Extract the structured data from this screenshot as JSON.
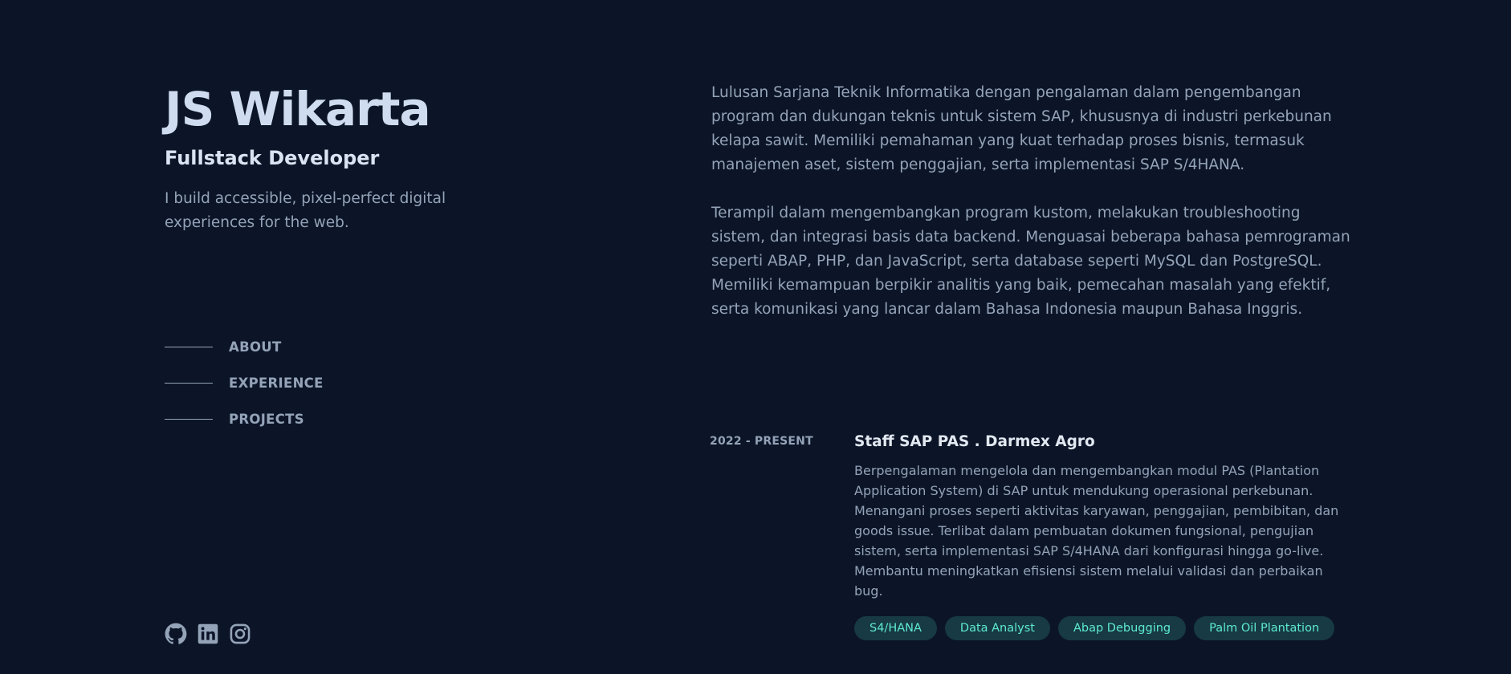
{
  "profile": {
    "name": "JS Wikarta",
    "role": "Fullstack Developer",
    "tagline": "I build accessible, pixel-perfect digital experiences for the web."
  },
  "nav": {
    "items": [
      {
        "label": "ABOUT"
      },
      {
        "label": "EXPERIENCE"
      },
      {
        "label": "PROJECTS"
      }
    ]
  },
  "social": {
    "icons": [
      "github-icon",
      "linkedin-icon",
      "instagram-icon"
    ]
  },
  "about": {
    "paragraphs": [
      "Lulusan Sarjana Teknik Informatika dengan pengalaman dalam pengembangan program dan dukungan teknis untuk sistem SAP, khususnya di industri perkebunan kelapa sawit. Memiliki pemahaman yang kuat terhadap proses bisnis, termasuk manajemen aset, sistem penggajian, serta implementasi SAP S/4HANA.",
      "Terampil dalam mengembangkan program kustom, melakukan troubleshooting sistem, dan integrasi basis data backend. Menguasai beberapa bahasa pemrograman seperti ABAP, PHP, dan JavaScript, serta database seperti MySQL dan PostgreSQL. Memiliki kemampuan berpikir analitis yang baik, pemecahan masalah yang efektif, serta komunikasi yang lancar dalam Bahasa Indonesia maupun Bahasa Inggris."
    ]
  },
  "experience": {
    "items": [
      {
        "period": "2022 - PRESENT",
        "title": "Staff SAP PAS . Darmex Agro",
        "description": "Berpengalaman mengelola dan mengembangkan modul PAS (Plantation Application System) di SAP untuk mendukung operasional perkebunan. Menangani proses seperti aktivitas karyawan, penggajian, pembibitan, dan goods issue. Terlibat dalam pembuatan dokumen fungsional, pengujian sistem, serta implementasi SAP S/4HANA dari konfigurasi hingga go-live. Membantu meningkatkan efisiensi sistem melalui validasi dan perbaikan bug.",
        "tags": [
          "S4/HANA",
          "Data Analyst",
          "Abap Debugging",
          "Palm Oil Plantation"
        ]
      }
    ]
  },
  "colors": {
    "background": "#0c1528",
    "heading": "#cfdcef",
    "text": "#94a3b8",
    "tag_bg": "#173a44",
    "tag_text": "#5eead4"
  }
}
